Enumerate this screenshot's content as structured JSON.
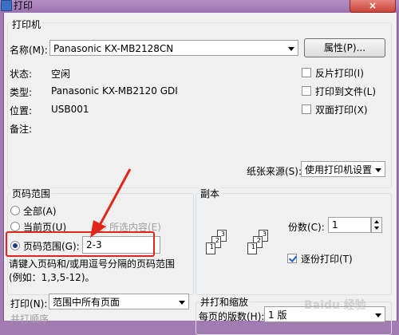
{
  "window": {
    "title": "打印",
    "close_label": "×"
  },
  "printer": {
    "section_label": "打印机",
    "name_label": "名称(M):",
    "name_value": "Panasonic KX-MB2128CN",
    "properties_button": "属性(P)...",
    "status_label": "状态:",
    "status_value": "空闲",
    "type_label": "类型:",
    "type_value": "Panasonic KX-MB2120 GDI",
    "location_label": "位置:",
    "location_value": "USB001",
    "comment_label": "备注:",
    "reverse_print": {
      "label": "反片打印(I)",
      "checked": false
    },
    "print_to_file": {
      "label": "打印到文件(L)",
      "checked": false
    },
    "duplex": {
      "label": "双面打印(X)",
      "checked": false
    },
    "paper_source_label": "纸张来源(S):",
    "paper_source_value": "使用打印机设置"
  },
  "page_range": {
    "section_label": "页码范围",
    "all_label": "全部(A)",
    "current_label": "当前页(U)",
    "selection_label": "所选内容(E)",
    "pages_label": "页码范围(G):",
    "pages_value": "2-3",
    "hint_line1": "请键入页码和/或用逗号分隔的页码范围",
    "hint_line2": "(例如：1,3,5-12)。"
  },
  "copies": {
    "section_label": "副本",
    "count_label": "份数(C):",
    "count_value": "1",
    "collate": {
      "label": "逐份打印(T)",
      "checked": true
    },
    "icon_pages": [
      "1",
      "2",
      "3",
      "1",
      "2",
      "3"
    ]
  },
  "print_what": {
    "label": "打印(N):",
    "value": "范围中所有页面"
  },
  "zoom": {
    "section_label": "并打和缩放",
    "pages_per_sheet_label": "每页的版数(H):",
    "pages_per_sheet_value": "1 版"
  },
  "order": {
    "section_label": "并打顺序"
  },
  "watermark_text": "Baidu 经验"
}
